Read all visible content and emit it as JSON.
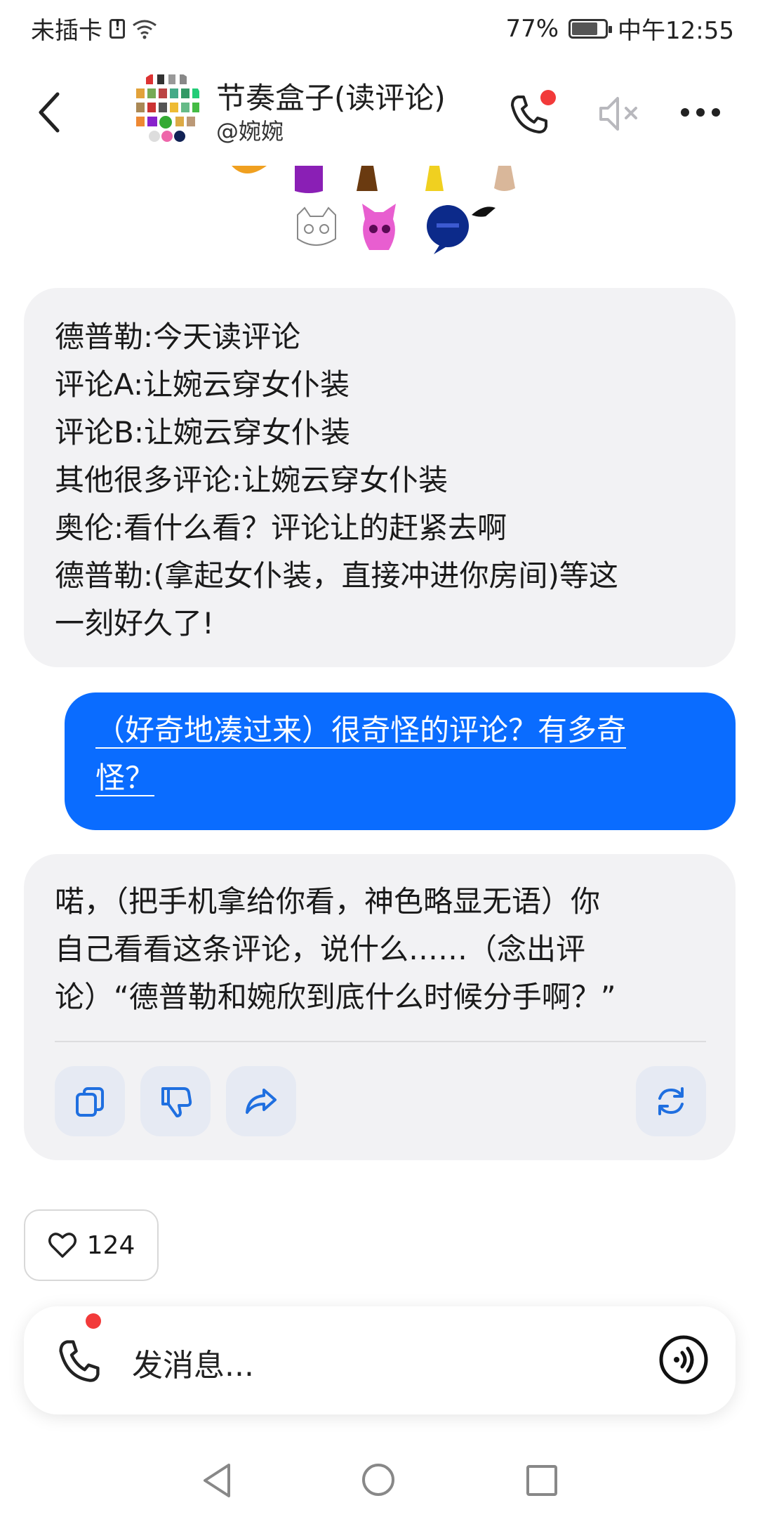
{
  "status": {
    "carrier": "未插卡",
    "battery": "77%",
    "time": "中午12:55"
  },
  "header": {
    "title": "节奏盒子(读评论)",
    "creator": "@婉婉"
  },
  "messages": {
    "ai_first": [
      "德普勒:今天读评论",
      "评论A:让婉云穿女仆装",
      "评论B:让婉云穿女仆装",
      "其他很多评论:让婉云穿女仆装",
      "奥伦:看什么看？评论让的赶紧去啊",
      "德普勒:(拿起女仆装，直接冲进你房间)等这",
      "一刻好久了!"
    ],
    "user": [
      "（好奇地凑过来）很奇怪的评论？有多奇",
      "怪？"
    ],
    "ai_second": [
      "喏，（把手机拿给你看，神色略显无语）你",
      "自己看看这条评论，说什么……（念出评",
      "论）“德普勒和婉欣到底什么时候分手啊？”"
    ]
  },
  "like": {
    "count": "124"
  },
  "input": {
    "placeholder": "发消息..."
  },
  "colors": {
    "accent": "#0a6cff",
    "ai_bubble": "#f2f2f4",
    "notification_dot": "#f23a3a",
    "action_icon": "#1f6fe0"
  },
  "icons": {
    "back": "chevron-left-icon",
    "call": "phone-icon",
    "mute": "speaker-mute-icon",
    "more": "more-dots-icon",
    "copy": "copy-icon",
    "dislike": "thumbs-down-icon",
    "share": "share-icon",
    "regenerate": "refresh-icon",
    "like": "heart-icon",
    "voice": "voice-icon"
  }
}
